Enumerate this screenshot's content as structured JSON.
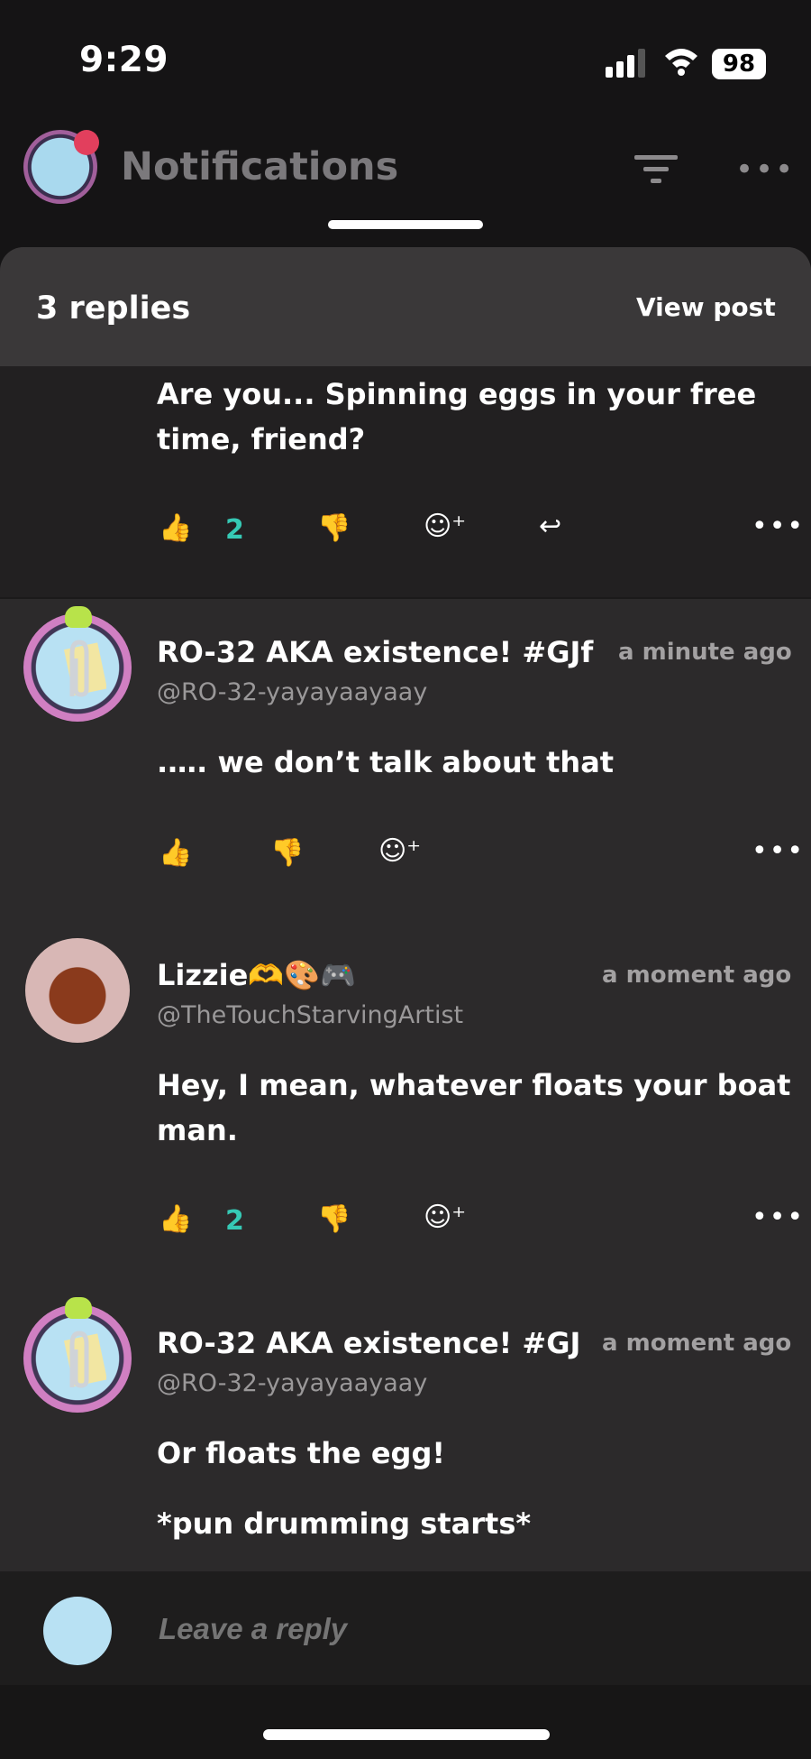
{
  "status": {
    "time": "9:29",
    "battery": "98"
  },
  "header": {
    "title": "Notifications"
  },
  "sheet": {
    "replies": "3 replies",
    "view_post": "View post"
  },
  "first_comment": {
    "line1": "Are you... Spinning eggs in your free",
    "line2": "time, friend?",
    "likes": "2"
  },
  "comments": [
    {
      "name": "RO-32 AKA existence!  #GJf",
      "handle": "@RO-32-yayayaayaay",
      "time": "a minute ago",
      "lines": [
        ".…. we don’t talk about that"
      ]
    },
    {
      "name": "Lizzie🫶🎨🎮",
      "handle": "@TheTouchStarvingArtist",
      "time": "a moment ago",
      "lines": [
        "Hey, I mean, whatever floats your boat",
        "man."
      ],
      "likes": "2"
    },
    {
      "name": "RO-32 AKA existence!  #GJ",
      "handle": "@RO-32-yayayaayaay",
      "time": "a moment ago",
      "lines": [
        "Or floats the egg!",
        "*pun drumming starts*"
      ]
    }
  ],
  "composer": {
    "placeholder": "Leave a reply"
  },
  "icons": {
    "like": "thumbs-up-icon",
    "dislike": "thumbs-down-icon",
    "react": "add-emoji-icon",
    "reply": "reply-icon",
    "more": "ellipsis-icon"
  }
}
